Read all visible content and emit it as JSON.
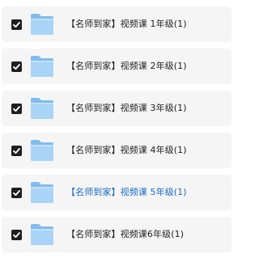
{
  "colors": {
    "row_bg": "#f5f5f6",
    "checkbox": "#1f1f1f",
    "text": "#222222",
    "active_text": "#1769c4",
    "folder_light": "#a9d3f7",
    "folder_dark": "#82bcee"
  },
  "items": [
    {
      "label": "【名师到家】视频课 1年级(1)",
      "checked": true,
      "icon": "folder-icon"
    },
    {
      "label": "【名师到家】视频课 2年级(1)",
      "checked": true,
      "icon": "folder-icon"
    },
    {
      "label": "【名师到家】视频课 3年级(1)",
      "checked": true,
      "icon": "folder-icon"
    },
    {
      "label": "【名师到家】视频课 4年级(1)",
      "checked": true,
      "icon": "folder-icon"
    },
    {
      "label": "【名师到家】视频课 5年级(1)",
      "checked": true,
      "icon": "folder-icon",
      "active": true
    },
    {
      "label": "【名师到家】视频课6年级(1)",
      "checked": true,
      "icon": "folder-icon"
    }
  ]
}
